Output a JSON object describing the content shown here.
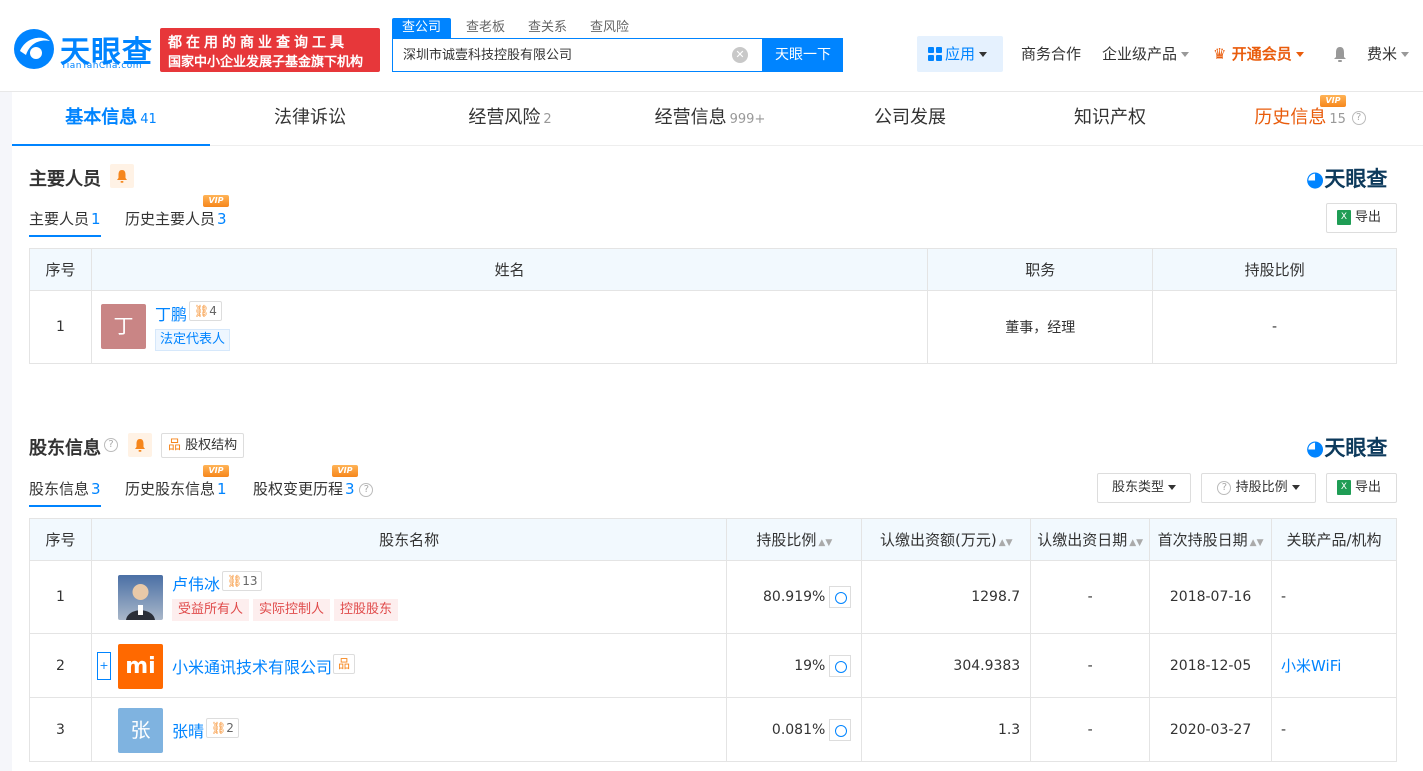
{
  "header": {
    "logo_text": "天眼查",
    "logo_sub": "TianYanCha.com",
    "slogan_line1": "都在用的商业查询工具",
    "slogan_line2": "国家中小企业发展子基金旗下机构",
    "search_tabs": [
      "查公司",
      "查老板",
      "查关系",
      "查风险"
    ],
    "search_value": "深圳市诚壹科技控股有限公司",
    "search_button": "天眼一下",
    "nav": {
      "app": "应用",
      "business": "商务合作",
      "enterprise": "企业级产品",
      "vip": "开通会员",
      "user": "费米"
    }
  },
  "tabs": [
    {
      "label": "基本信息",
      "count": "41"
    },
    {
      "label": "法律诉讼",
      "count": ""
    },
    {
      "label": "经营风险",
      "count": "2"
    },
    {
      "label": "经营信息",
      "count": "999+"
    },
    {
      "label": "公司发展",
      "count": ""
    },
    {
      "label": "知识产权",
      "count": ""
    },
    {
      "label": "历史信息",
      "count": "15"
    }
  ],
  "vip_label": "VIP",
  "watermark": "天眼查",
  "export_label": "导出",
  "personnel": {
    "title": "主要人员",
    "subtabs": [
      {
        "label": "主要人员",
        "count": "1"
      },
      {
        "label": "历史主要人员",
        "count": "3"
      }
    ],
    "headers": [
      "序号",
      "姓名",
      "职务",
      "持股比例"
    ],
    "rows": [
      {
        "index": "1",
        "avatar_char": "丁",
        "name": "丁鹏",
        "relations": "4",
        "tag": "法定代表人",
        "position": "董事，经理",
        "ratio": "-"
      }
    ]
  },
  "shareholders": {
    "title": "股东信息",
    "structure_button": "股权结构",
    "subtabs": [
      {
        "label": "股东信息",
        "count": "3"
      },
      {
        "label": "历史股东信息",
        "count": "1"
      },
      {
        "label": "股权变更历程",
        "count": "3"
      }
    ],
    "filter_type": "股东类型",
    "filter_ratio": "持股比例",
    "headers": [
      "序号",
      "股东名称",
      "持股比例",
      "认缴出资额(万元)",
      "认缴出资日期",
      "首次持股日期",
      "关联产品/机构"
    ],
    "rows": [
      {
        "index": "1",
        "name": "卢伟冰",
        "relations": "13",
        "tags": [
          "受益所有人",
          "实际控制人",
          "控股股东"
        ],
        "ratio": "80.919%",
        "capital": "1298.7",
        "date": "-",
        "first_date": "2018-07-16",
        "product": "-"
      },
      {
        "index": "2",
        "name": "小米通讯技术有限公司",
        "logo": "mi",
        "ratio": "19%",
        "capital": "304.9383",
        "date": "-",
        "first_date": "2018-12-05",
        "product": "小米WiFi"
      },
      {
        "index": "3",
        "name": "张晴",
        "avatar_char": "张",
        "relations": "2",
        "ratio": "0.081%",
        "capital": "1.3",
        "date": "-",
        "first_date": "2020-03-27",
        "product": "-"
      }
    ]
  },
  "colors": {
    "brand": "#0084ff",
    "vip": "#e95c0c",
    "slogan_bg": "#e7373a",
    "mi": "#ff6900"
  }
}
